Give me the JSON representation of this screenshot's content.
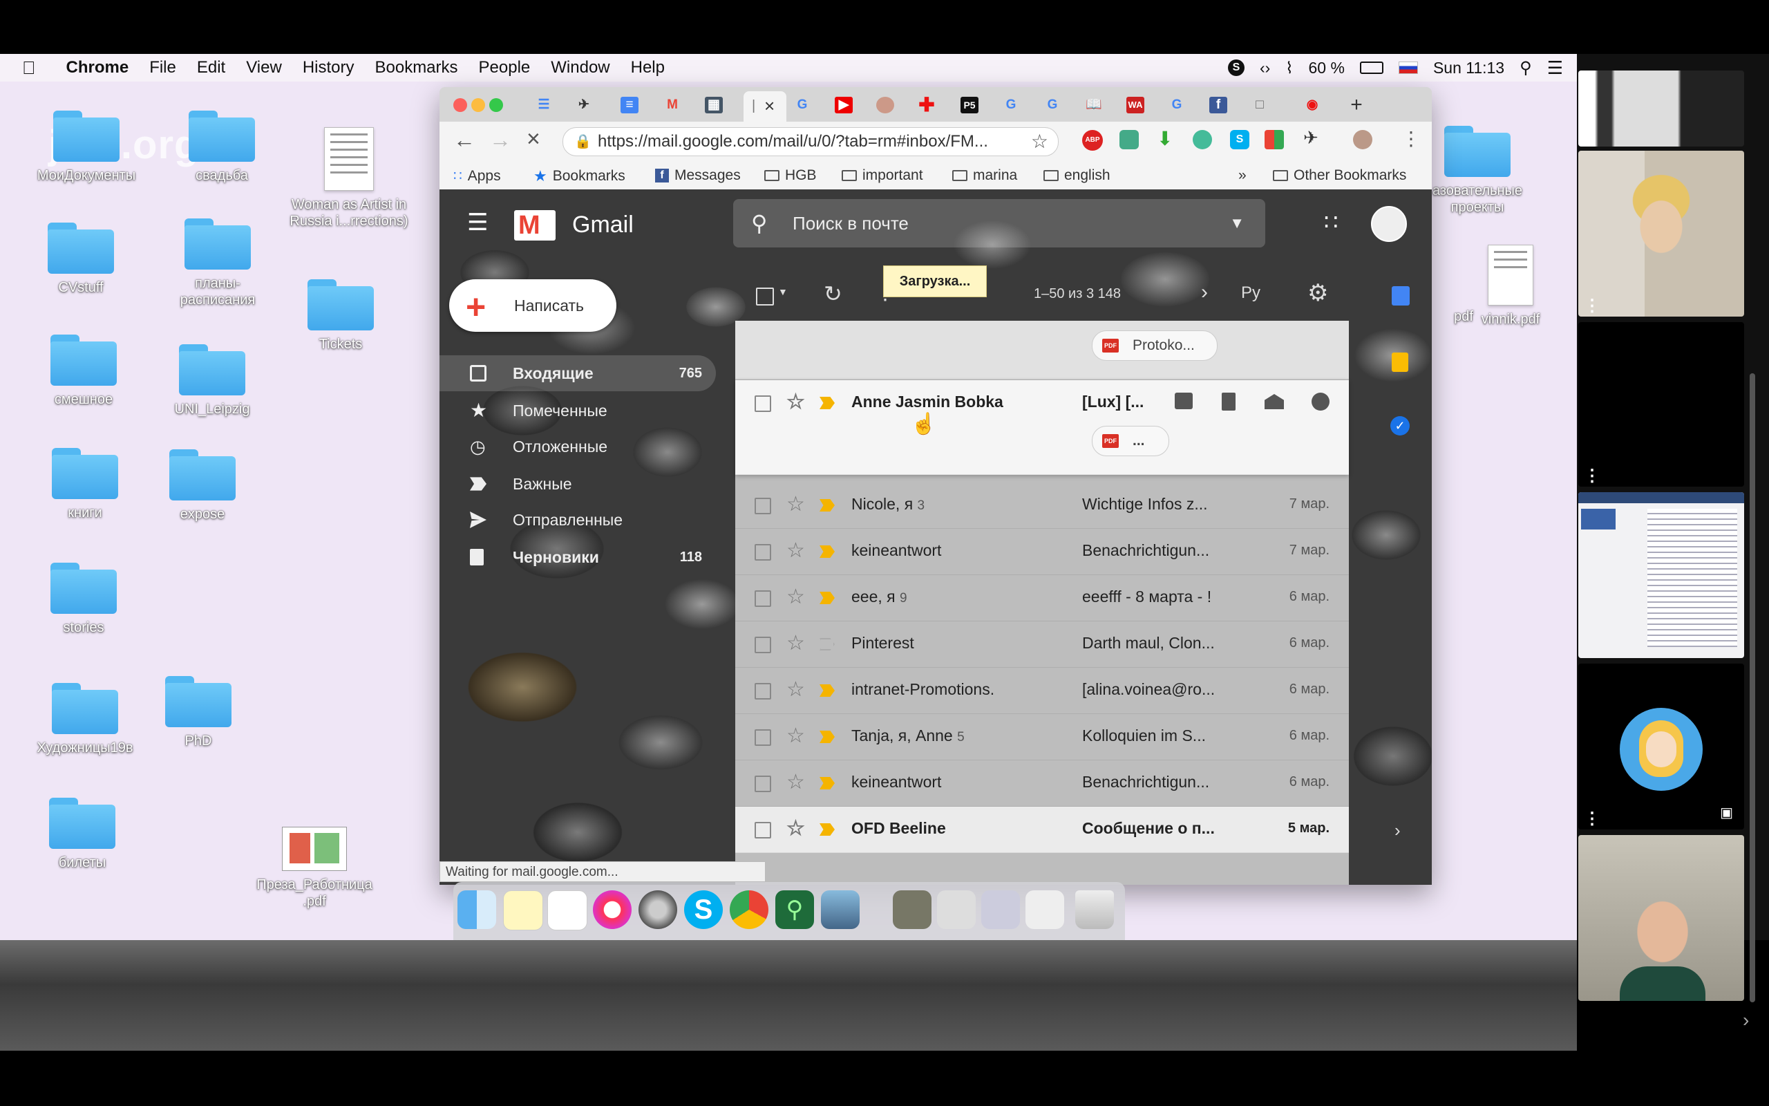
{
  "menubar": {
    "apple": "",
    "app": "Chrome",
    "items": [
      "File",
      "Edit",
      "View",
      "History",
      "Bookmarks",
      "People",
      "Window",
      "Help"
    ],
    "battery": "60 %",
    "clock": "Sun 11:13"
  },
  "watermark": "jitsi.org",
  "desktop": {
    "left_icons": [
      "МоиДокументы",
      "CVstuff",
      "смешное",
      "книги",
      "stories",
      "Художницы19в",
      "билеты"
    ],
    "mid_icons": [
      "свадьба",
      "планы-\nрасписания",
      "UNI_Leipzig",
      "expose",
      "PhD"
    ],
    "doc_woman": "Woman as Artist in\nRussia i...rrections)",
    "tickets": "Tickets",
    "preza": "Преза_Работница\n.pdf",
    "right_folder": "азовательные\nпроекты",
    "vinnik": "vinnik.pdf",
    "pdf_small": "pdf"
  },
  "browser": {
    "url": "https://mail.google.com/mail/u/0/?tab=rm#inbox/FM...",
    "status": "Waiting for mail.google.com...",
    "bookmarks": {
      "apps": "Apps",
      "bookmarks": "Bookmarks",
      "messages": "Messages",
      "hgb": "HGB",
      "important": "important",
      "marina": "marina",
      "english": "english",
      "more": "»",
      "other": "Other Bookmarks"
    }
  },
  "gmail": {
    "logo": "Gmail",
    "search_placeholder": "Поиск в почте",
    "tooltip": "Загрузка...",
    "compose": "Написать",
    "pagination": "1–50 из 3 148",
    "lang": "Ру",
    "nav": [
      {
        "label": "Входящие",
        "count": "765"
      },
      {
        "label": "Помеченные",
        "count": ""
      },
      {
        "label": "Отложенные",
        "count": ""
      },
      {
        "label": "Важные",
        "count": ""
      },
      {
        "label": "Отправленные",
        "count": ""
      },
      {
        "label": "Черновики",
        "count": "118"
      }
    ],
    "top_attachment": "Protoko...",
    "hover_row": {
      "sender": "Anne Jasmin Bobka",
      "subject": "[Lux] [...",
      "attachment": "..."
    },
    "rows": [
      {
        "sender": "Nicole, я",
        "count": "3",
        "subject": "Wichtige Infos z...",
        "date": "7 мар."
      },
      {
        "sender": "keineantwort",
        "count": "",
        "subject": "Benachrichtigun...",
        "date": "7 мар."
      },
      {
        "sender": "eee, я",
        "count": "9",
        "subject": "eeefff - 8 марта - !",
        "date": "6 мар."
      },
      {
        "sender": "Pinterest",
        "count": "",
        "subject": "Darth maul, Clon...",
        "date": "6 мар."
      },
      {
        "sender": "intranet-Promotions.",
        "count": "",
        "subject": "[alina.voinea@ro...",
        "date": "6 мар."
      },
      {
        "sender": "Tanja, я, Anne",
        "count": "5",
        "subject": "Kolloquien im S...",
        "date": "6 мар."
      },
      {
        "sender": "keineantwort",
        "count": "",
        "subject": "Benachrichtigun...",
        "date": "6 мар."
      },
      {
        "sender": "OFD Beeline",
        "count": "",
        "subject": "Сообщение о п...",
        "date": "5 мар."
      }
    ]
  },
  "colors": {
    "folder": "#4fb6f2",
    "gmail_red": "#ea4335",
    "desktop": "#efe6f6"
  }
}
